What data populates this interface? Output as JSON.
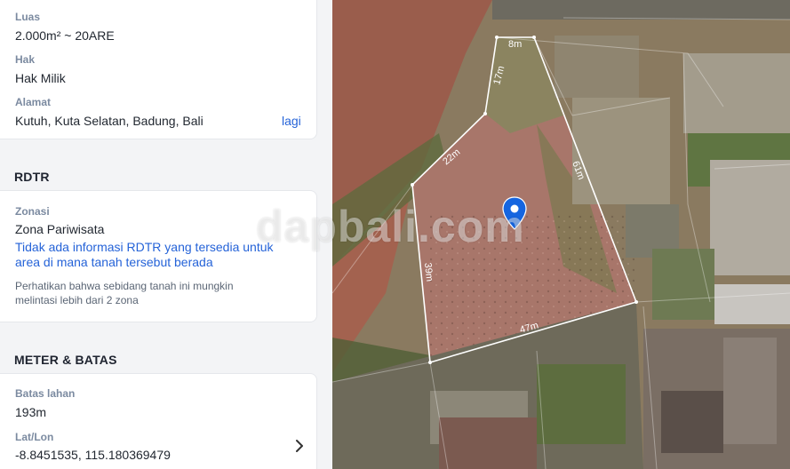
{
  "luas": {
    "label": "Luas",
    "value": "2.000m² ~ 20ARE"
  },
  "hak": {
    "label": "Hak",
    "value": "Hak Milik"
  },
  "alamat": {
    "label": "Alamat",
    "value": "Kutuh, Kuta Selatan, Badung, Bali",
    "more": "lagi"
  },
  "rdtr": {
    "title": "RDTR",
    "zonasi_label": "Zonasi",
    "zonasi_value": "Zona Pariwisata",
    "info_line1": "Tidak ada informasi RDTR yang tersedia untuk",
    "info_line2": "area di mana tanah tersebut berada",
    "note_line1": "Perhatikan bahwa sebidang tanah ini mungkin",
    "note_line2": "melintasi lebih dari 2 zona"
  },
  "meter": {
    "title": "METER & BATAS",
    "batas_label": "Batas lahan",
    "batas_value": "193m",
    "latlon_label": "Lat/Lon",
    "latlon_value": "-8.8451535, 115.180369479"
  },
  "map": {
    "edges": [
      "8m",
      "17m",
      "22m",
      "61m",
      "39m",
      "47m"
    ],
    "watermark": "dapbali.com",
    "boundary_color": "#ffffff",
    "pin_color": "#1565e0",
    "icons": [
      "location-pin-icon",
      "chevron-right-icon"
    ]
  }
}
